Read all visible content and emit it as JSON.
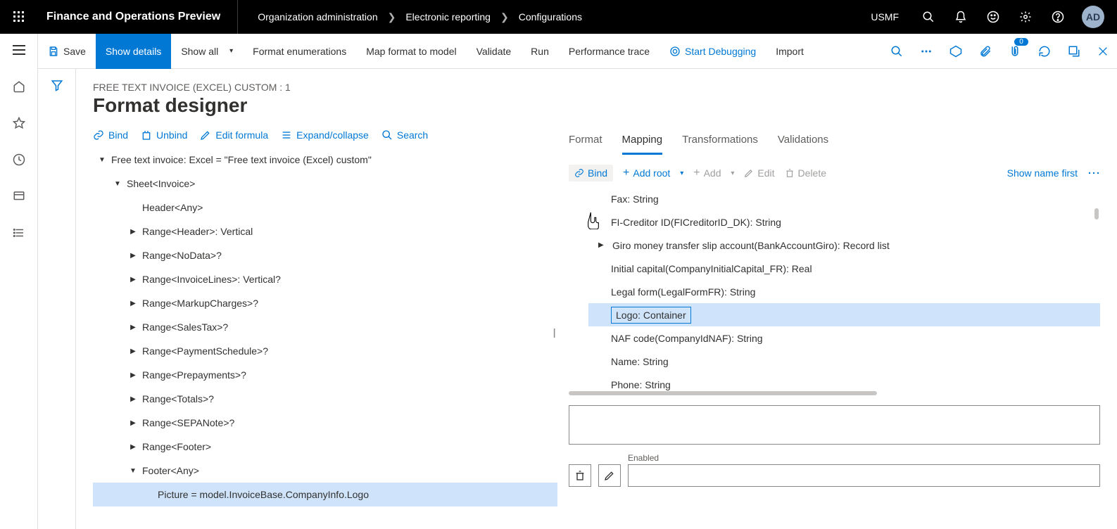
{
  "topbar": {
    "app_title": "Finance and Operations Preview",
    "breadcrumbs": [
      "Organization administration",
      "Electronic reporting",
      "Configurations"
    ],
    "company": "USMF",
    "avatar": "AD"
  },
  "cmdbar": {
    "save": "Save",
    "show_details": "Show details",
    "show_all": "Show all",
    "format_enum": "Format enumerations",
    "map_format": "Map format to model",
    "validate": "Validate",
    "run": "Run",
    "perf_trace": "Performance trace",
    "start_debug": "Start Debugging",
    "import": "Import",
    "badge_count": "0"
  },
  "page": {
    "subtitle": "FREE TEXT INVOICE (EXCEL) CUSTOM : 1",
    "title": "Format designer"
  },
  "left_toolbar": {
    "bind": "Bind",
    "unbind": "Unbind",
    "edit_formula": "Edit formula",
    "expand": "Expand/collapse",
    "search": "Search"
  },
  "tree": [
    {
      "indent": 0,
      "arrow": "down",
      "label": "Free text invoice: Excel = \"Free text invoice (Excel) custom\""
    },
    {
      "indent": 1,
      "arrow": "down",
      "label": "Sheet<Invoice>"
    },
    {
      "indent": 2,
      "arrow": "blank",
      "label": "Header<Any>"
    },
    {
      "indent": 2,
      "arrow": "right",
      "label": "Range<Header>: Vertical"
    },
    {
      "indent": 2,
      "arrow": "right",
      "label": "Range<NoData>?"
    },
    {
      "indent": 2,
      "arrow": "right",
      "label": "Range<InvoiceLines>: Vertical?"
    },
    {
      "indent": 2,
      "arrow": "right",
      "label": "Range<MarkupCharges>?"
    },
    {
      "indent": 2,
      "arrow": "right",
      "label": "Range<SalesTax>?"
    },
    {
      "indent": 2,
      "arrow": "right",
      "label": "Range<PaymentSchedule>?"
    },
    {
      "indent": 2,
      "arrow": "right",
      "label": "Range<Prepayments>?"
    },
    {
      "indent": 2,
      "arrow": "right",
      "label": "Range<Totals>?"
    },
    {
      "indent": 2,
      "arrow": "right",
      "label": "Range<SEPANote>?"
    },
    {
      "indent": 2,
      "arrow": "right",
      "label": "Range<Footer>"
    },
    {
      "indent": 2,
      "arrow": "down",
      "label": "Footer<Any>"
    },
    {
      "indent": 3,
      "arrow": "blank",
      "label": "Picture = model.InvoiceBase.CompanyInfo.Logo",
      "selected": true
    }
  ],
  "right_tabs": {
    "format": "Format",
    "mapping": "Mapping",
    "transformations": "Transformations",
    "validations": "Validations"
  },
  "right_toolbar": {
    "bind": "Bind",
    "add_root": "Add root",
    "add": "Add",
    "edit": "Edit",
    "delete": "Delete",
    "show_name": "Show name first"
  },
  "datalist": [
    {
      "arrow": "blank",
      "label": "Fax: String"
    },
    {
      "arrow": "blank",
      "label": "FI-Creditor ID(FICreditorID_DK): String"
    },
    {
      "arrow": "right",
      "label": "Giro money transfer slip account(BankAccountGiro): Record list"
    },
    {
      "arrow": "blank",
      "label": "Initial capital(CompanyInitialCapital_FR): Real"
    },
    {
      "arrow": "blank",
      "label": "Legal form(LegalFormFR): String"
    },
    {
      "arrow": "blank",
      "label": "Logo: Container",
      "selected": true
    },
    {
      "arrow": "blank",
      "label": "NAF code(CompanyIdNAF): String"
    },
    {
      "arrow": "blank",
      "label": "Name: String"
    },
    {
      "arrow": "blank",
      "label": "Phone: String"
    }
  ],
  "bottom": {
    "enabled_label": "Enabled"
  }
}
